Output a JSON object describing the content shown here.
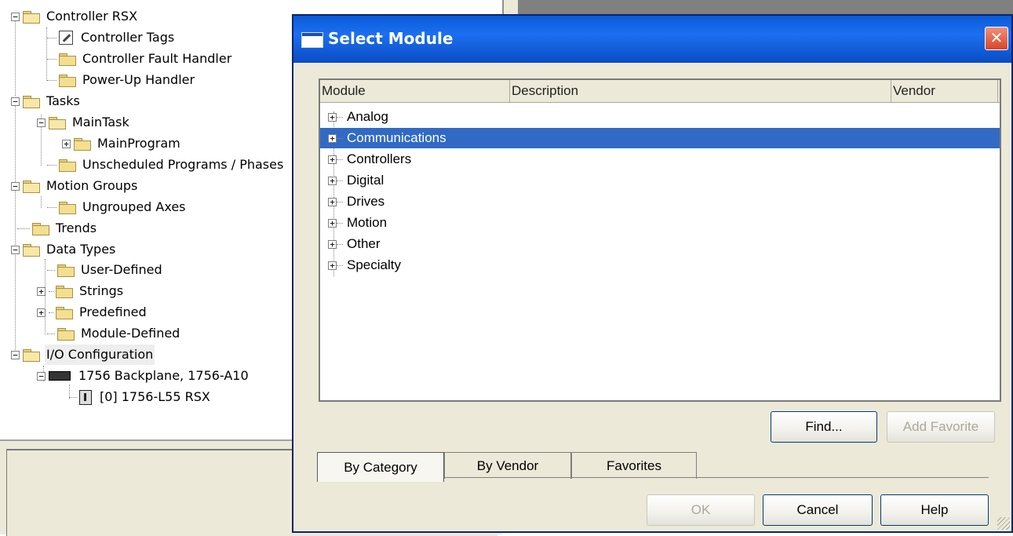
{
  "tree": {
    "items": [
      {
        "label": "Controller RSX"
      },
      {
        "label": "Controller Tags"
      },
      {
        "label": "Controller Fault Handler"
      },
      {
        "label": "Power-Up Handler"
      },
      {
        "label": "Tasks"
      },
      {
        "label": "MainTask"
      },
      {
        "label": "MainProgram"
      },
      {
        "label": "Unscheduled Programs / Phases"
      },
      {
        "label": "Motion Groups"
      },
      {
        "label": "Ungrouped Axes"
      },
      {
        "label": "Trends"
      },
      {
        "label": "Data Types"
      },
      {
        "label": "User-Defined"
      },
      {
        "label": "Strings"
      },
      {
        "label": "Predefined"
      },
      {
        "label": "Module-Defined"
      },
      {
        "label": "I/O Configuration"
      },
      {
        "label": "1756 Backplane, 1756-A10"
      },
      {
        "label": "[0] 1756-L55 RSX"
      }
    ],
    "expander_minus": "−",
    "expander_plus": "+"
  },
  "dialog": {
    "title": "Select Module",
    "close_glyph": "✕",
    "columns": [
      "Module",
      "Description",
      "Vendor"
    ],
    "categories": [
      {
        "label": "Analog"
      },
      {
        "label": "Communications",
        "selected": true
      },
      {
        "label": "Controllers"
      },
      {
        "label": "Digital"
      },
      {
        "label": "Drives"
      },
      {
        "label": "Motion"
      },
      {
        "label": "Other"
      },
      {
        "label": "Specialty"
      }
    ],
    "buttons": {
      "find": "Find...",
      "add_favorite": "Add Favorite",
      "ok": "OK",
      "cancel": "Cancel",
      "help": "Help"
    },
    "tabs": [
      "By Category",
      "By Vendor",
      "Favorites"
    ],
    "active_tab": "By Category",
    "selection_color": "#316ac5",
    "title_color": "#0a5bd8"
  }
}
